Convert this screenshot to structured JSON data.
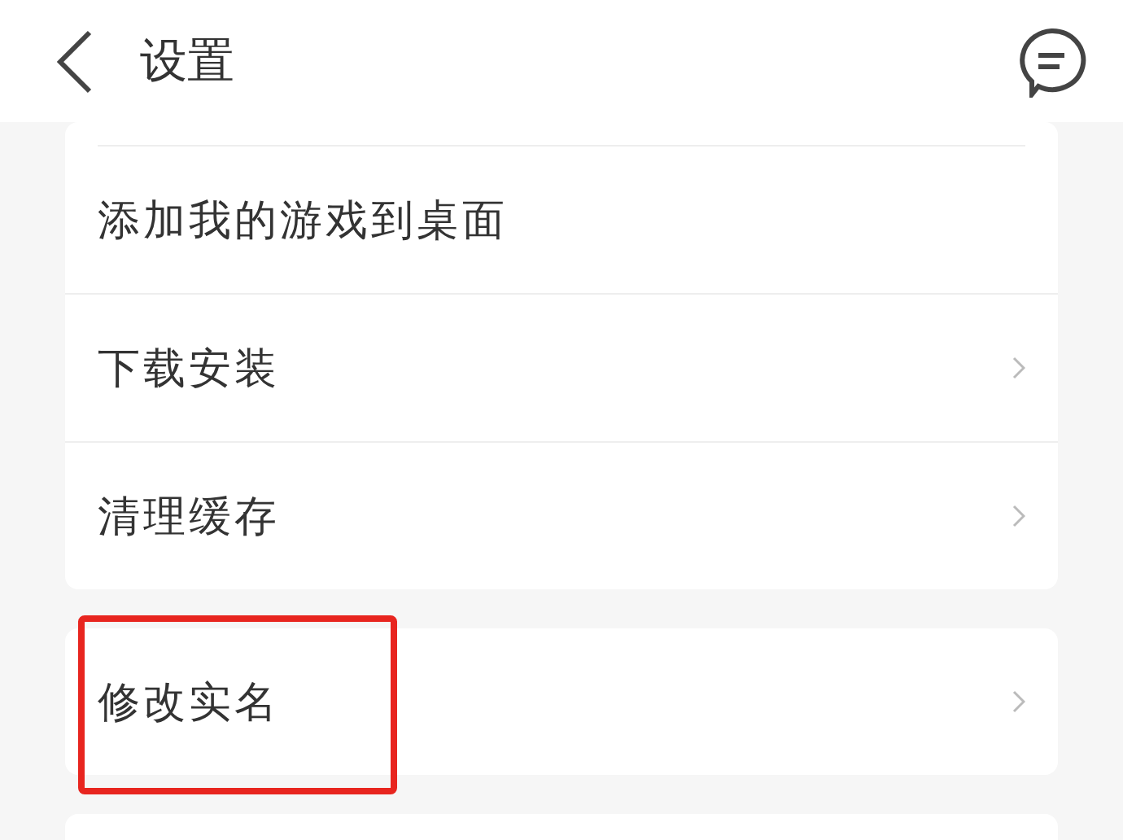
{
  "header": {
    "title": "设置"
  },
  "groups": [
    {
      "items": [
        {
          "label": "添加我的游戏到桌面",
          "chevron": false,
          "highlighted": false
        },
        {
          "label": "下载安装",
          "chevron": true,
          "highlighted": false
        },
        {
          "label": "清理缓存",
          "chevron": true,
          "highlighted": false
        }
      ]
    },
    {
      "items": [
        {
          "label": "修改实名",
          "chevron": true,
          "highlighted": true
        }
      ]
    }
  ]
}
